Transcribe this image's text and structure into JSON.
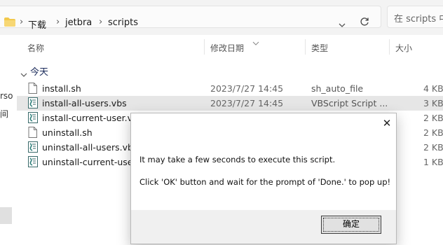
{
  "breadcrumb": {
    "items": [
      "下载",
      "jetbra",
      "scripts"
    ],
    "separator": "›"
  },
  "search": {
    "placeholder": "在 scripts 中搜索"
  },
  "left_pane": {
    "fragments": [
      "rso",
      "间"
    ]
  },
  "columns": {
    "name": "名称",
    "date": "修改日期",
    "type": "类型",
    "size": "大小"
  },
  "group": {
    "label": "今天"
  },
  "files": [
    {
      "name": "install.sh",
      "date": "2023/7/27 14:45",
      "type": "sh_auto_file",
      "size": "4 KB",
      "icon": "document-icon",
      "selected": false
    },
    {
      "name": "install-all-users.vbs",
      "date": "2023/7/27 14:45",
      "type": "VBScript Script ...",
      "size": "3 KB",
      "icon": "vbscript-icon",
      "selected": true
    },
    {
      "name": "install-current-user.vbs",
      "date": "",
      "type": "",
      "size": "2 KB",
      "icon": "vbscript-icon",
      "selected": false
    },
    {
      "name": "uninstall.sh",
      "date": "",
      "type": "",
      "size": "2 KB",
      "icon": "document-icon",
      "selected": false
    },
    {
      "name": "uninstall-all-users.vbs",
      "date": "",
      "type": "",
      "size": "2 KB",
      "icon": "vbscript-icon",
      "selected": false
    },
    {
      "name": "uninstall-current-user.vbs",
      "date": "",
      "type": "",
      "size": "1 KB",
      "icon": "vbscript-icon",
      "selected": false
    }
  ],
  "dialog": {
    "close_glyph": "✕",
    "line1": "It may take a few seconds to execute this script.",
    "line2": "Click 'OK' button and wait for the prompt of 'Done.' to pop up!",
    "ok_label": "确定"
  },
  "colors": {
    "folder": "#f2c94c",
    "selection": "#e6e6e6",
    "dialog_bg": "#f0f0f0"
  }
}
